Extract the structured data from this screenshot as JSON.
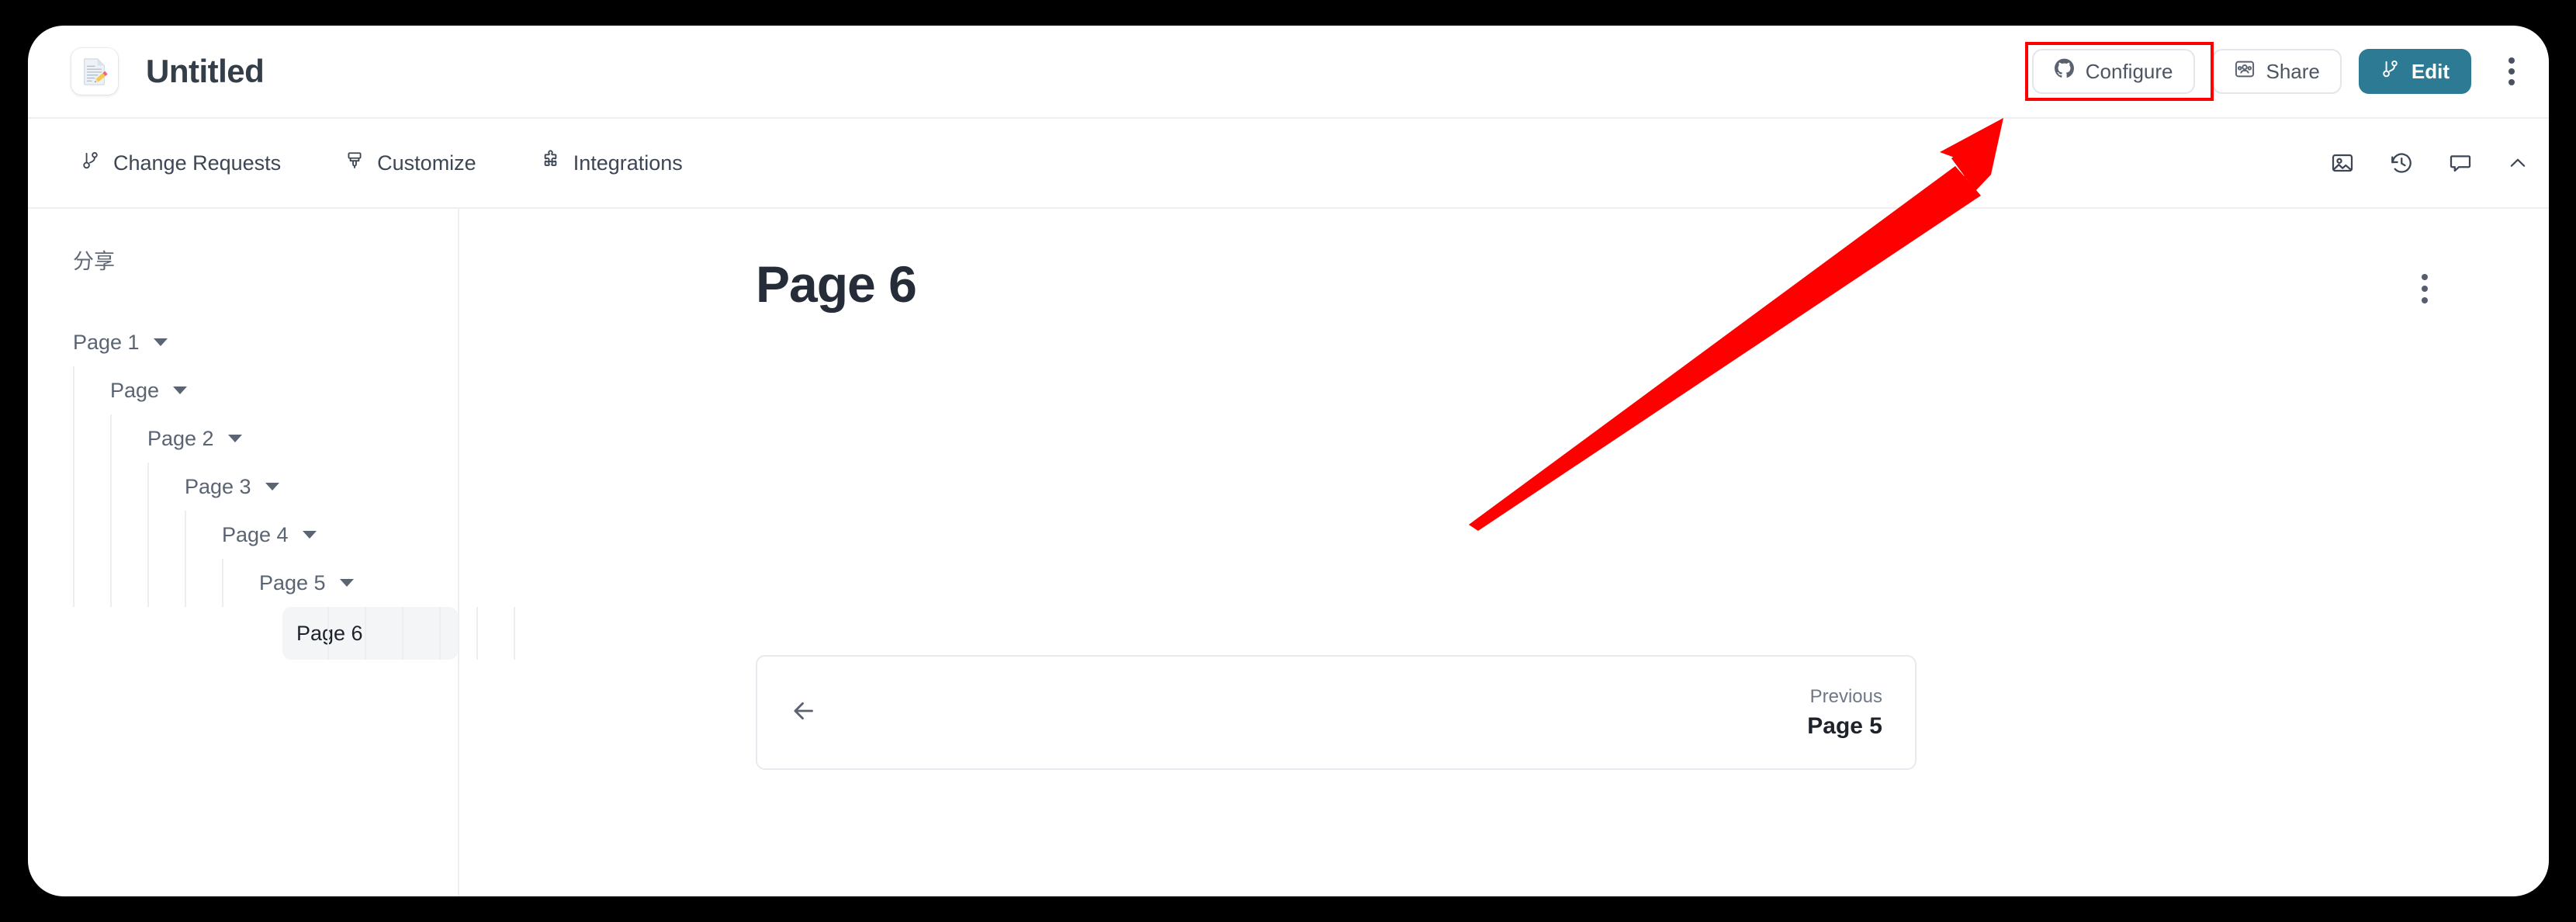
{
  "window": {
    "header": {
      "doc_icon": "memo-pencil-icon",
      "title": "Untitled",
      "actions": {
        "configure_label": "Configure",
        "configure_icon": "github-icon",
        "share_label": "Share",
        "share_icon": "people-card-icon",
        "edit_label": "Edit",
        "edit_icon": "git-branch-icon",
        "kebab_icon": "more-vertical-icon"
      },
      "highlight_color": "#ff0000",
      "primary_color": "#2c7a94"
    },
    "toolbar": {
      "items": [
        {
          "label": "Change Requests",
          "icon": "git-branch-icon"
        },
        {
          "label": "Customize",
          "icon": "paintbrush-icon"
        },
        {
          "label": "Integrations",
          "icon": "puzzle-piece-icon"
        }
      ],
      "right_icons": [
        {
          "name": "image-icon"
        },
        {
          "name": "history-clock-icon"
        },
        {
          "name": "comment-bubble-icon"
        },
        {
          "name": "chevron-up-icon"
        }
      ]
    },
    "sidebar": {
      "heading": "分享",
      "tree": [
        {
          "label": "Page 1",
          "depth": 0,
          "has_caret": true,
          "selected": false
        },
        {
          "label": "Page",
          "depth": 1,
          "has_caret": true,
          "selected": false
        },
        {
          "label": "Page 2",
          "depth": 2,
          "has_caret": true,
          "selected": false
        },
        {
          "label": "Page 3",
          "depth": 3,
          "has_caret": true,
          "selected": false
        },
        {
          "label": "Page 4",
          "depth": 4,
          "has_caret": true,
          "selected": false
        },
        {
          "label": "Page 5",
          "depth": 5,
          "has_caret": true,
          "selected": false
        },
        {
          "label": "Page 6",
          "depth": 6,
          "has_caret": false,
          "selected": true
        }
      ]
    },
    "main": {
      "page_title": "Page 6",
      "page_kebab_icon": "more-vertical-icon",
      "pager": {
        "back_icon": "arrow-left-icon",
        "kicker": "Previous",
        "target": "Page 5"
      }
    },
    "annotation": {
      "type": "arrow",
      "color": "#ff0000",
      "points_to": "Configure"
    }
  }
}
